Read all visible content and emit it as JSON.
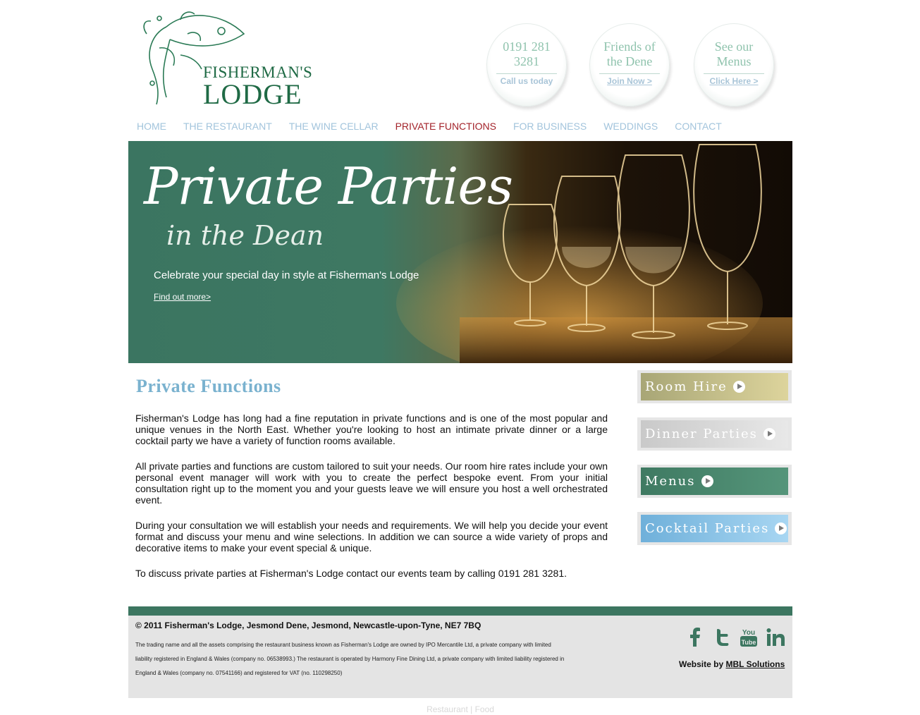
{
  "logo": {
    "line1": "FISHERMAN'S",
    "line2": "LODGE"
  },
  "circles": [
    {
      "title": "0191 281 3281",
      "subtitle": "Call us today"
    },
    {
      "title": "Friends of the Dene",
      "subtitle": "Join Now >"
    },
    {
      "title": "See our Menus",
      "subtitle": "Click Here >"
    }
  ],
  "nav": [
    "HOME",
    "THE RESTAURANT",
    "THE WINE CELLAR",
    "PRIVATE FUNCTIONS",
    "FOR BUSINESS",
    "WEDDINGS",
    "CONTACT"
  ],
  "nav_active": "PRIVATE FUNCTIONS",
  "hero": {
    "title": "Private Parties",
    "subtitle": "in the Dean",
    "tagline": "Celebrate your special day in style at Fisherman's Lodge",
    "link": "Find out more>"
  },
  "main": {
    "title": "Private Functions",
    "paragraphs": [
      "Fisherman's Lodge has long had a fine reputation in private functions and is one of the most popular and unique venues in the North East. Whether you're looking to host an intimate private dinner or a large cocktail party we have a variety of function rooms available.",
      "All private parties and functions are custom tailored to suit your needs. Our room hire rates include your own personal event manager will work with you to create the perfect bespoke event. From your initial consultation right up to the moment you and your guests leave we will ensure you host a well orchestrated event.",
      "During your consultation we will establish your needs and requirements. We will help you decide your event format and discuss your menu and wine selections. In addition we can source a wide variety of props and decorative items to make your event special & unique.",
      "To discuss private parties at Fisherman's Lodge contact our events team by calling 0191 281 3281."
    ]
  },
  "side_buttons": [
    {
      "label": "Room Hire",
      "color_from": "#a8a676",
      "color_to": "#ddd49c"
    },
    {
      "label": "Dinner Parties",
      "color_from": "#c9c9c9",
      "color_to": "#e8e8e8"
    },
    {
      "label": "Menus",
      "color_from": "#3f7a62",
      "color_to": "#55957a"
    },
    {
      "label": "Cocktail Parties",
      "color_from": "#6fb0da",
      "color_to": "#a8d6f2"
    }
  ],
  "footer": {
    "copyright": "© 2011 Fisherman's Lodge, Jesmond Dene, Jesmond, Newcastle-upon-Tyne, NE7 7BQ",
    "legal": "The trading name and all the assets comprising the restaurant business known as Fisherman's Lodge are owned by IPO Mercantile Ltd, a private company with limited liability registered in England & Wales (company no. 06538993.) The restaurant is operated by Harmony Fine Dining Ltd, a private company with limited liability registered in England & Wales (company no. 07541166) and registered for VAT (no. 110298250)",
    "credit_prefix": "Website by ",
    "credit_link": "MBL Solutions",
    "social_icons": [
      "facebook-icon",
      "twitter-icon",
      "youtube-icon",
      "linkedin-icon"
    ]
  },
  "bottom_links": "Restaurant | Food",
  "colors": {
    "accent_green": "#3c7660",
    "nav_blue": "#a2c4dc",
    "nav_active": "#a3232a",
    "title_blue": "#7ab2cf"
  }
}
